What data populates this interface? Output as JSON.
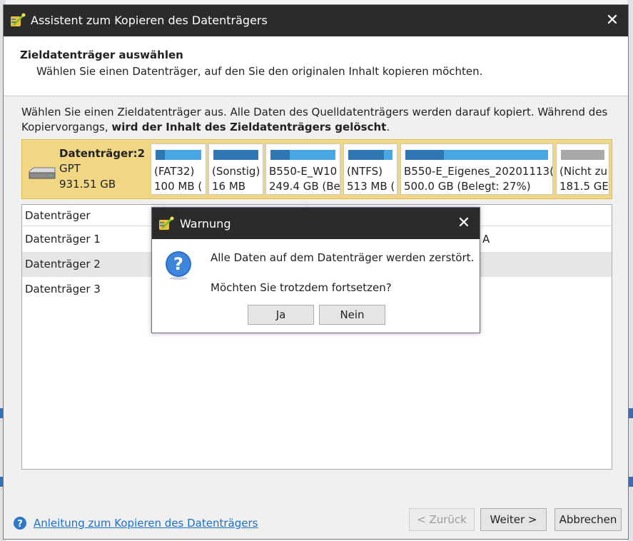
{
  "window": {
    "title": "Assistent zum Kopieren des Datenträgers",
    "close_glyph": "✕"
  },
  "header": {
    "title": "Zieldatenträger auswählen",
    "subtitle": "Wählen Sie einen Datenträger, auf den Sie den originalen Inhalt kopieren möchten."
  },
  "instruction": {
    "text_before": "Wählen Sie einen Zieldatenträger aus. Alle Daten des Quelldatenträgers werden darauf kopiert. Während des Kopiervorgangs, ",
    "text_bold": "wird der Inhalt des Zieldatenträgers gelöscht",
    "text_after": "."
  },
  "disk_map": {
    "name": "Datenträger:2",
    "style": "GPT",
    "size": "931.51 GB",
    "partitions": [
      {
        "line1": "(FAT32)",
        "line2": "100 MB (",
        "used_fraction": 0.2,
        "color": "#48a7e3"
      },
      {
        "line1": "(Sonstig)",
        "line2": "16 MB",
        "used_fraction": 1.0,
        "color": "#48a7e3"
      },
      {
        "line1": "B550-E_W10",
        "line2": "249.4 GB (Be",
        "used_fraction": 0.3,
        "color": "#48a7e3"
      },
      {
        "line1": "(NTFS)",
        "line2": "513 MB (",
        "used_fraction": 0.8,
        "color": "#48a7e3"
      },
      {
        "line1": "B550-E_Eigenes_20201113(",
        "line2": "500.0 GB (Belegt: 27%)",
        "used_fraction": 0.27,
        "color": "#48a7e3"
      },
      {
        "line1": "(Nicht zu",
        "line2": "181.5 GE",
        "used_fraction": 0.0,
        "color": "#a9a9a9"
      }
    ]
  },
  "table": {
    "columns": [
      "Datenträger",
      "",
      ""
    ],
    "rows": [
      {
        "disk": "Datenträger 1",
        "extra": "A",
        "selected": false
      },
      {
        "disk": "Datenträger 2",
        "extra": "",
        "selected": true
      },
      {
        "disk": "Datenträger 3",
        "extra": "",
        "selected": false
      }
    ]
  },
  "footer": {
    "help_link": "Anleitung zum Kopieren des Datenträgers",
    "back_label": "< Zurück",
    "next_label": "Weiter >",
    "cancel_label": "Abbrechen"
  },
  "warning": {
    "title": "Warnung",
    "close_glyph": "✕",
    "message1": "Alle Daten auf dem Datenträger werden zerstört.",
    "message2": "Möchten Sie trotzdem fortsetzen?",
    "yes_label": "Ja",
    "no_label": "Nein"
  },
  "colors": {
    "titlebar": "#2b2b2b",
    "disk_highlight": "#f1d683",
    "partition_bar": "#48a7e3",
    "partition_used": "#2f77b3",
    "link": "#1c6fc4"
  }
}
